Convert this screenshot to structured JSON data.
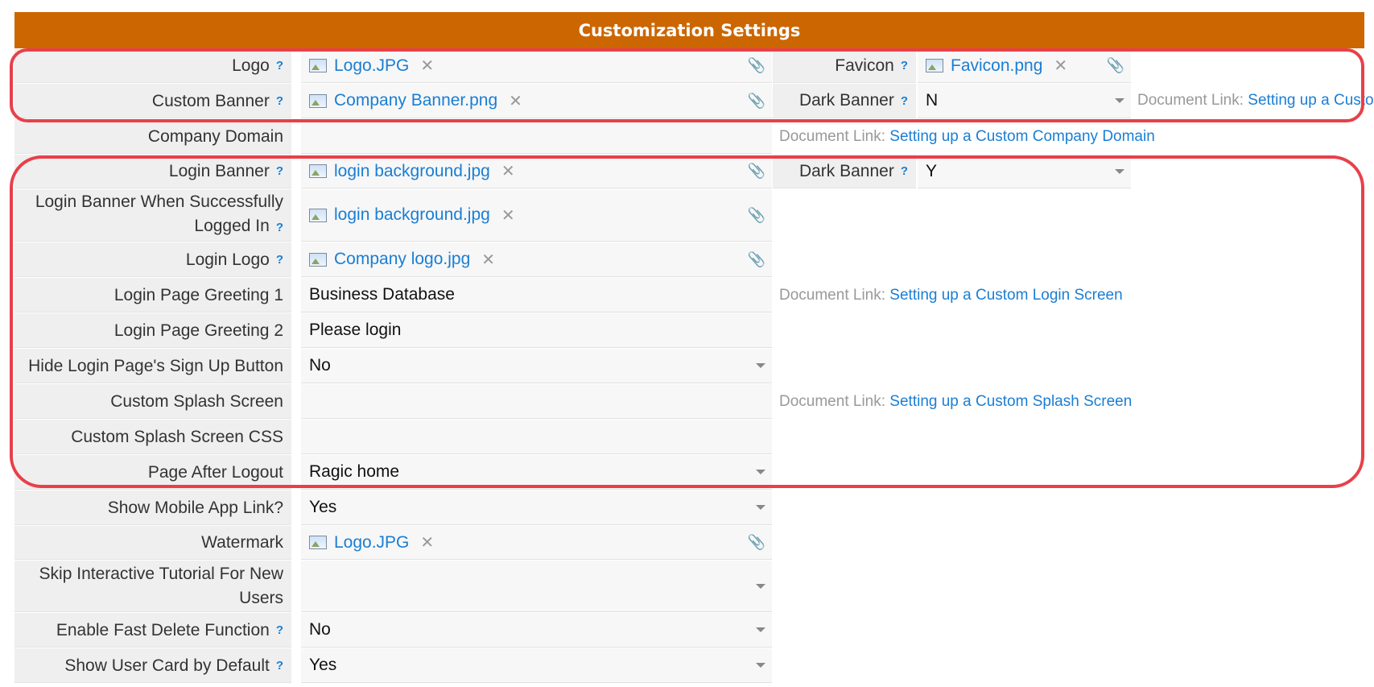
{
  "header": {
    "title": "Customization Settings"
  },
  "rows": {
    "logo": {
      "label": "Logo",
      "file": "Logo.JPG"
    },
    "custom_banner": {
      "label": "Custom Banner",
      "file": "Company Banner.png"
    },
    "company_domain": {
      "label": "Company Domain",
      "value": ""
    },
    "login_banner": {
      "label": "Login Banner",
      "file": "login background.jpg"
    },
    "login_banner_success": {
      "label": "Login Banner When Successfully Logged In",
      "file": "login background.jpg"
    },
    "login_logo": {
      "label": "Login Logo",
      "file": "Company logo.jpg"
    },
    "greeting1": {
      "label": "Login Page Greeting 1",
      "value": "Business Database"
    },
    "greeting2": {
      "label": "Login Page Greeting 2",
      "value": "Please login"
    },
    "hide_signup": {
      "label": "Hide Login Page's Sign Up Button",
      "value": "No"
    },
    "splash": {
      "label": "Custom Splash Screen",
      "value": ""
    },
    "splash_css": {
      "label": "Custom Splash Screen CSS",
      "value": ""
    },
    "after_logout": {
      "label": "Page After Logout",
      "value": "Ragic home"
    },
    "mobile_link": {
      "label": "Show Mobile App Link?",
      "value": "Yes"
    },
    "watermark": {
      "label": "Watermark",
      "file": "Logo.JPG"
    },
    "skip_tutorial": {
      "label": "Skip Interactive Tutorial For New Users",
      "value": ""
    },
    "fast_delete": {
      "label": "Enable Fast Delete Function",
      "value": "No"
    },
    "user_card": {
      "label": "Show User Card by Default",
      "value": "Yes"
    }
  },
  "right": {
    "favicon": {
      "label": "Favicon",
      "file": "Favicon.png"
    },
    "dark_banner_1": {
      "label": "Dark Banner",
      "value": "N"
    },
    "dark_banner_2": {
      "label": "Dark Banner",
      "value": "Y"
    }
  },
  "docs": {
    "prefix": "Document Link:",
    "banner_link": "Setting up a Custo",
    "domain_link": "Setting up a Custom Company Domain",
    "login_link": "Setting up a Custom Login Screen",
    "splash_link": "Setting up a Custom Splash Screen"
  },
  "help_glyph": "?",
  "remove_glyph": "✕",
  "colors": {
    "header": "#cc6600",
    "link": "#1a7ed4",
    "highlight": "#e8404a"
  }
}
